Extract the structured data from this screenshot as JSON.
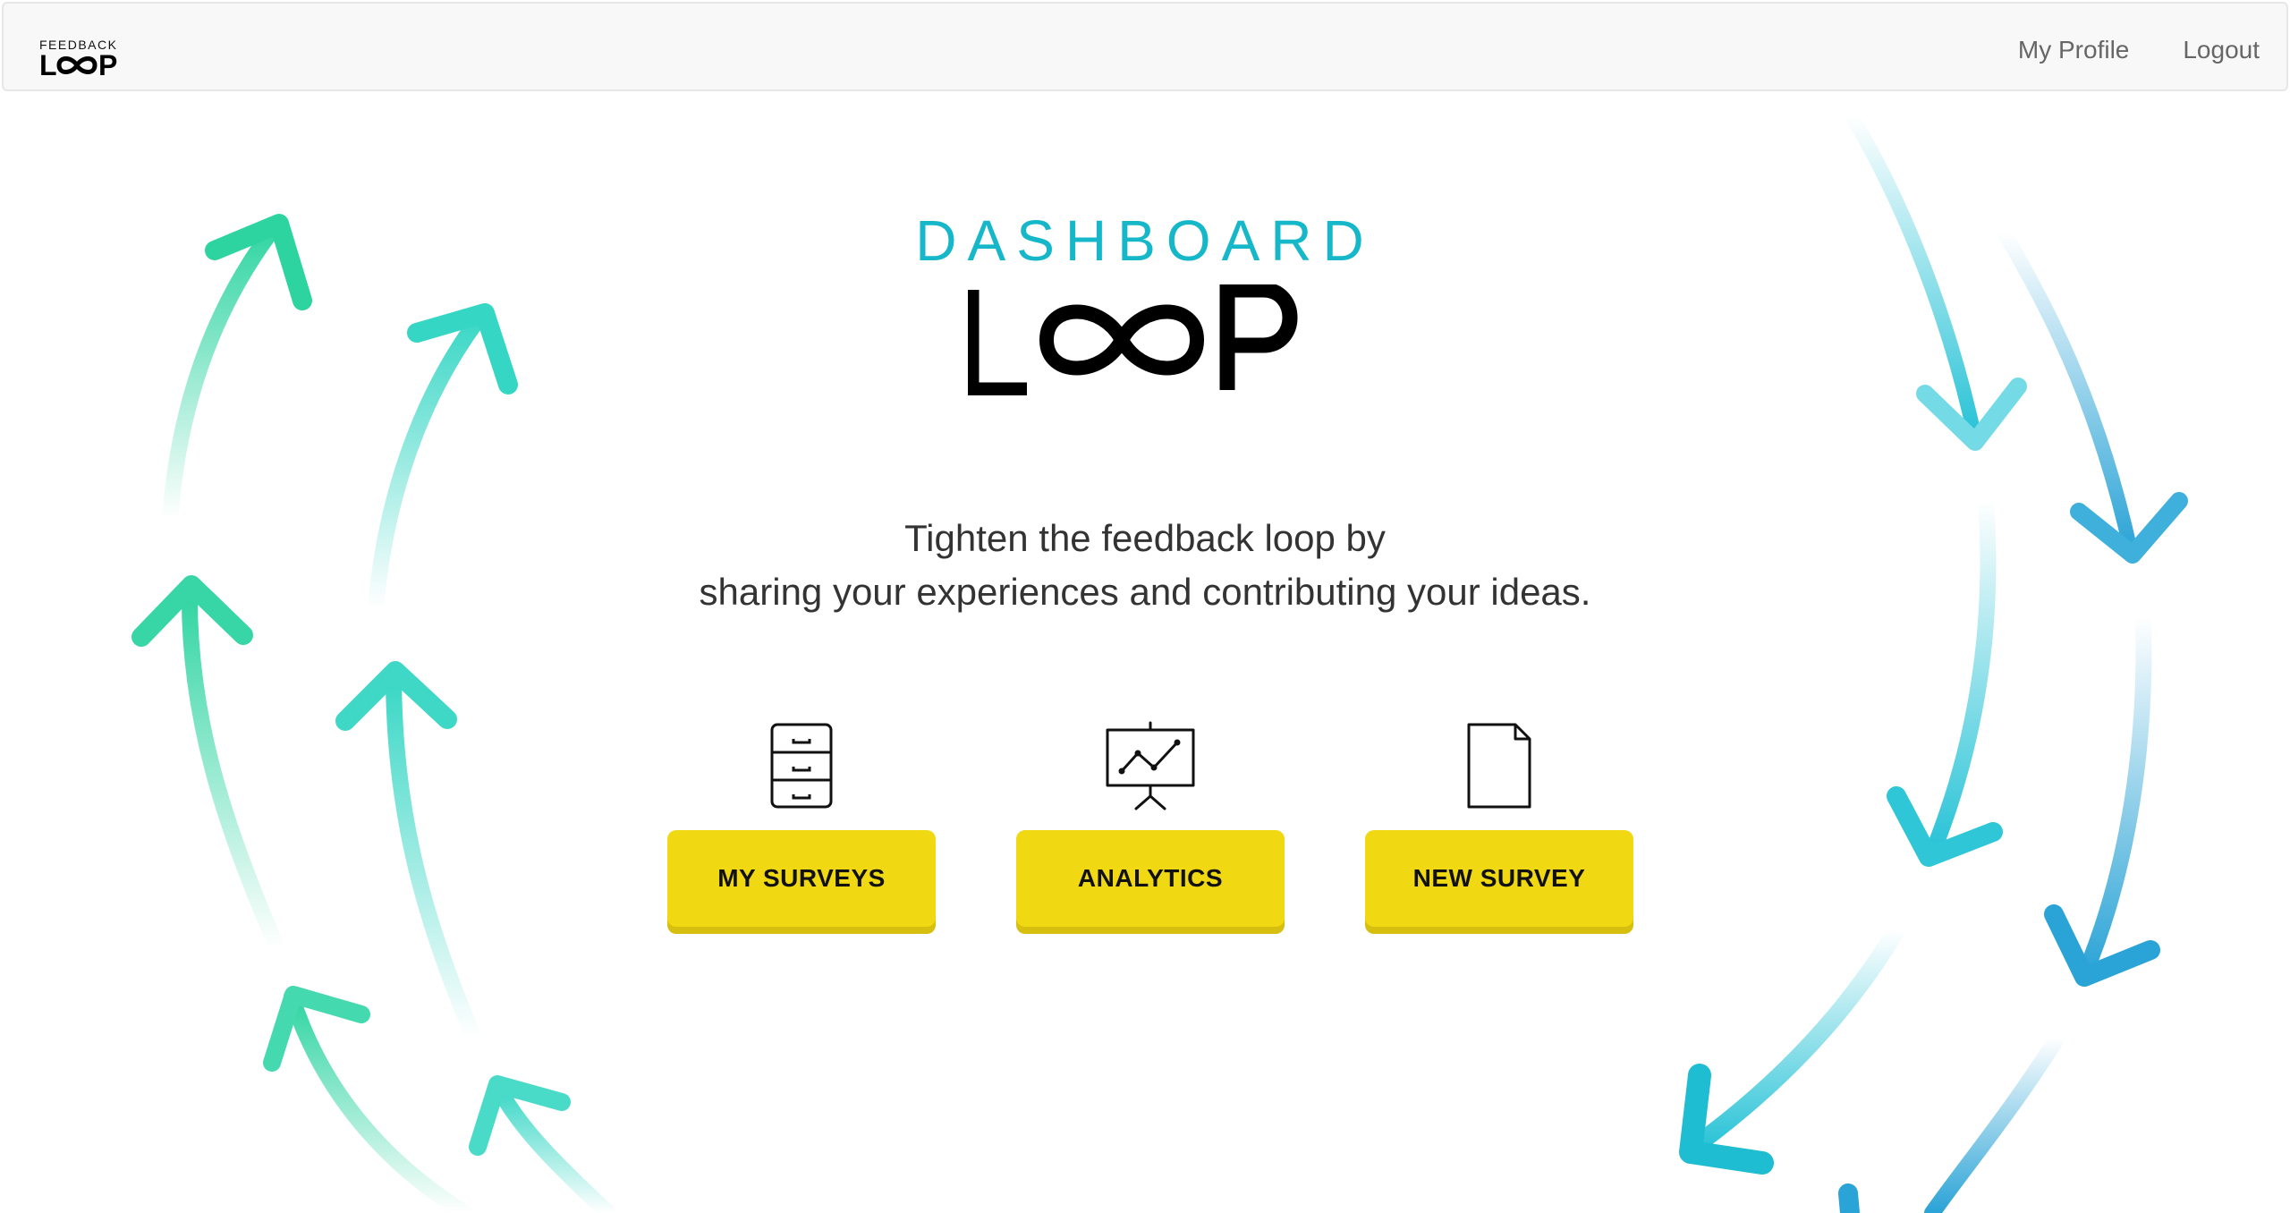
{
  "navbar": {
    "brand_small": "FEEDBACK",
    "brand_big": "LOOP",
    "links": [
      {
        "label": "My Profile"
      },
      {
        "label": "Logout"
      }
    ]
  },
  "hero": {
    "title": "DASHBOARD",
    "logo_text": "LOOP",
    "tagline_line1": "Tighten the feedback loop by",
    "tagline_line2": "sharing your experiences and contributing your ideas."
  },
  "actions": [
    {
      "label": "MY SURVEYS",
      "icon": "file-cabinet-icon"
    },
    {
      "label": "ANALYTICS",
      "icon": "presentation-chart-icon"
    },
    {
      "label": "NEW SURVEY",
      "icon": "document-icon"
    }
  ],
  "colors": {
    "accent_teal": "#16b7c9",
    "arrow_green": "#2dd4a0",
    "arrow_blue": "#2aa3d6",
    "button_yellow": "#f0d812"
  }
}
